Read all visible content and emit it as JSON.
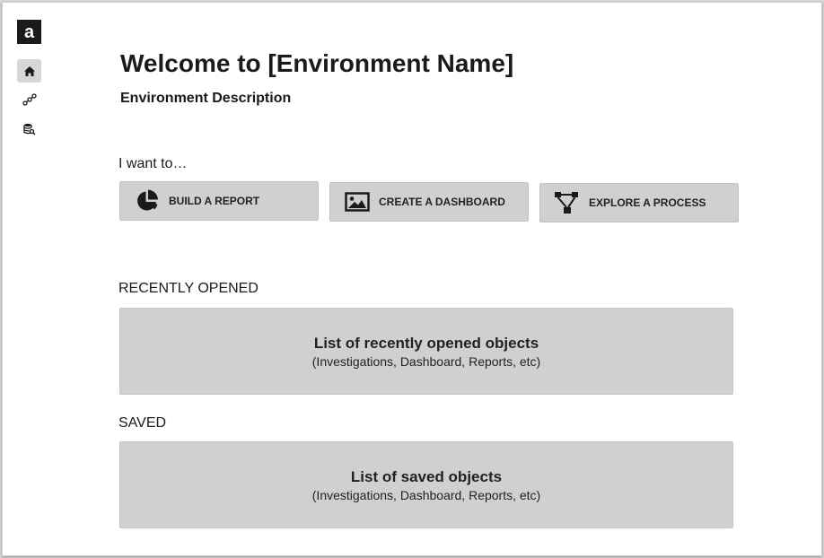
{
  "sidebar": {
    "logo_letter": "a",
    "items": [
      {
        "icon": "home-icon",
        "active": true
      },
      {
        "icon": "process-icon",
        "active": false
      },
      {
        "icon": "database-search-icon",
        "active": false
      }
    ]
  },
  "main": {
    "title": "Welcome to [Environment Name]",
    "description": "Environment Description",
    "i_want_to_label": "I want to…",
    "actions": [
      {
        "label": "BUILD A REPORT",
        "icon": "pie-chart-icon"
      },
      {
        "label": "CREATE A DASHBOARD",
        "icon": "image-icon"
      },
      {
        "label": "EXPLORE A PROCESS",
        "icon": "process-flow-icon"
      }
    ],
    "recently_opened": {
      "label": "RECENTLY OPENED",
      "title": "List of recently opened objects",
      "subtitle": "(Investigations, Dashboard, Reports, etc)"
    },
    "saved": {
      "label": "SAVED",
      "title": "List of saved objects",
      "subtitle": "(Investigations, Dashboard, Reports, etc)"
    }
  },
  "colors": {
    "button_bg": "#d0d0d0",
    "logo_bg": "#1a1a1a",
    "active_nav_bg": "#d6d6d6"
  }
}
